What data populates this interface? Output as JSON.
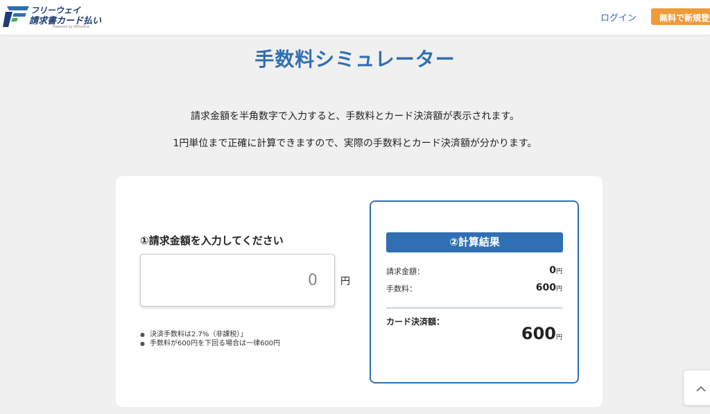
{
  "header": {
    "logo_line1": "フリーウェイ",
    "logo_line2": "請求書カード払い",
    "logo_line3": "Powered by Winvoice",
    "login_label": "ログイン",
    "signup_label": "無料で新規登録"
  },
  "page": {
    "title": "手数料シミュレーター",
    "description_line1": "請求金額を半角数字で入力すると、手数料とカード決済額が表示されます。",
    "description_line2": "1円単位まで正確に計算できますので、実際の手数料とカード決済額が分かります。"
  },
  "calculator": {
    "input_label": "①請求金額を入力してください",
    "input_placeholder": "0",
    "input_unit": "円",
    "notes": [
      "決済手数料は2.7%（非課税）」",
      "手数料が600円を下回る場合は一律600円"
    ]
  },
  "result": {
    "heading": "②計算結果",
    "invoice_label": "請求金額：",
    "invoice_value": "0",
    "fee_label": "手数料：",
    "fee_value": "600",
    "total_label": "カード決済額：",
    "total_value": "600",
    "unit": "円"
  },
  "colors": {
    "primary": "#2f6fb4",
    "accent_orange": "#ee9b3a",
    "background": "#f0f0f0"
  },
  "icons": {
    "logo": "freeway-logo-icon",
    "scroll_top": "chevron-up-icon"
  }
}
